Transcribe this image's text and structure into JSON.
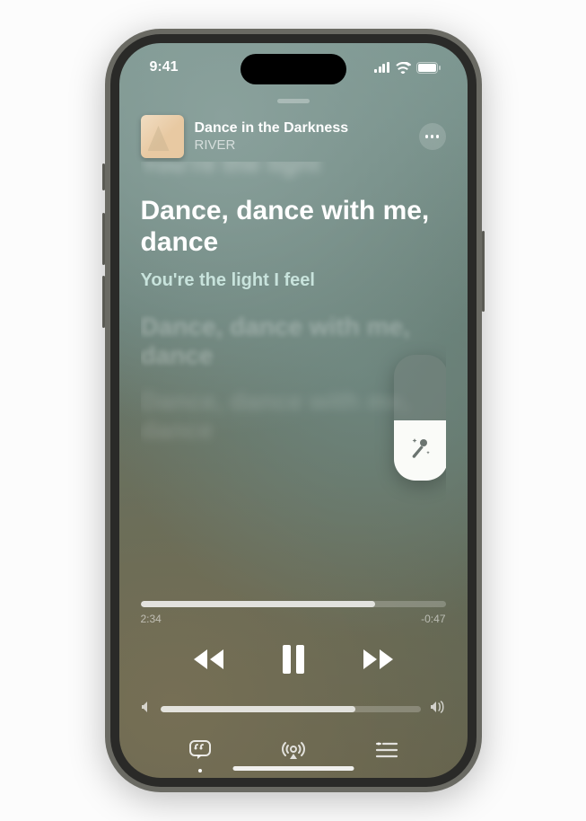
{
  "status": {
    "time": "9:41"
  },
  "track": {
    "title": "Dance in the Darkness",
    "artist": "RIVER"
  },
  "lyrics": {
    "prev": "You're the light",
    "current": "Dance, dance with me, dance",
    "next": "You're the light I feel",
    "after1": "Dance, dance with me, dance",
    "after2": "Dance, dance with me, dance"
  },
  "progress": {
    "elapsed": "2:34",
    "remaining": "-0:47"
  },
  "icons": {
    "more": "ellipsis",
    "mic": "microphone-sparkle",
    "lyrics_btn": "quote-bubble",
    "airplay": "airplay",
    "queue": "list"
  }
}
